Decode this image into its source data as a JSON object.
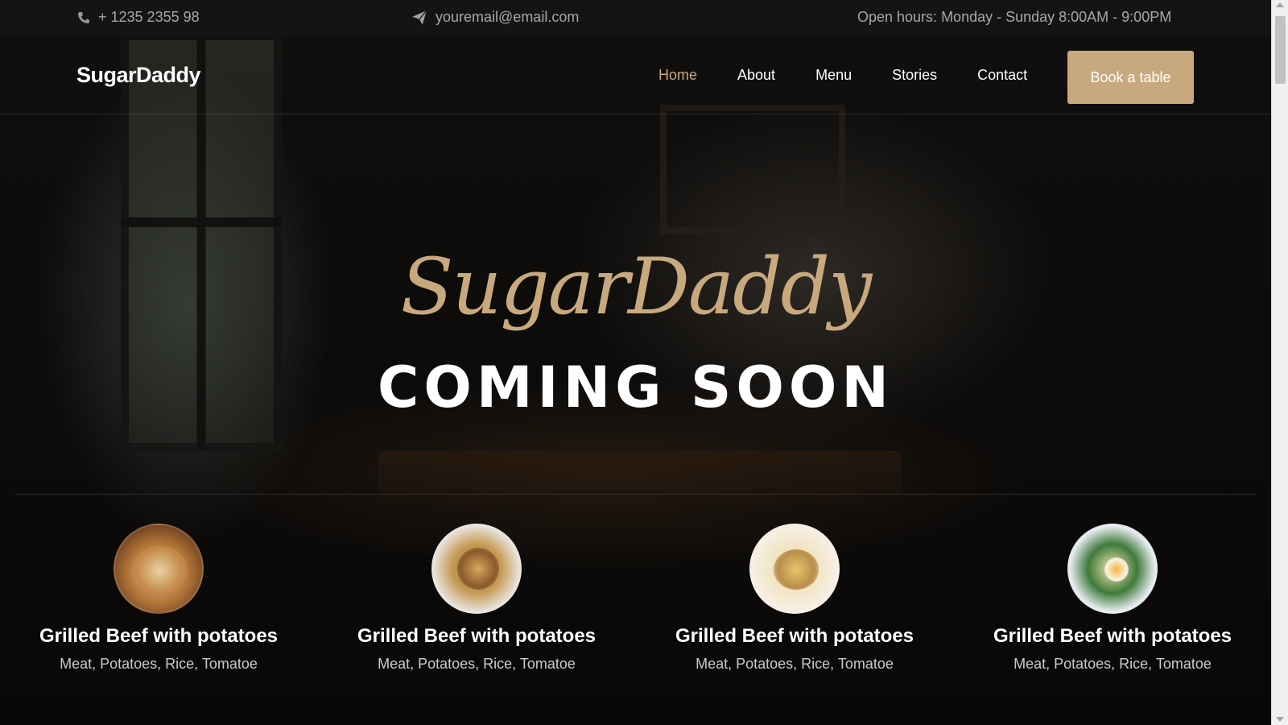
{
  "topbar": {
    "phone": "+ 1235 2355 98",
    "email": "youremail@email.com",
    "hours": "Open hours: Monday - Sunday 8:00AM - 9:00PM",
    "phone_icon": "phone-icon",
    "email_icon": "paper-plane-icon"
  },
  "navbar": {
    "brand": "SugarDaddy",
    "links": [
      {
        "label": "Home",
        "active": true
      },
      {
        "label": "About",
        "active": false
      },
      {
        "label": "Menu",
        "active": false
      },
      {
        "label": "Stories",
        "active": false
      },
      {
        "label": "Contact",
        "active": false
      }
    ],
    "cta": "Book a table"
  },
  "hero": {
    "script_title": "SugarDaddy",
    "headline": "COMING SOON"
  },
  "dishes": [
    {
      "name": "Grilled Beef with potatoes",
      "ingredients": "Meat, Potatoes, Rice, Tomatoe",
      "photo": "noodle-dish-photo"
    },
    {
      "name": "Grilled Beef with potatoes",
      "ingredients": "Meat, Potatoes, Rice, Tomatoe",
      "photo": "salad-bowl-photo"
    },
    {
      "name": "Grilled Beef with potatoes",
      "ingredients": "Meat, Potatoes, Rice, Tomatoe",
      "photo": "banana-bowl-photo"
    },
    {
      "name": "Grilled Beef with potatoes",
      "ingredients": "Meat, Potatoes, Rice, Tomatoe",
      "photo": "egg-salad-photo"
    }
  ],
  "colors": {
    "accent": "#c8a97e",
    "topbar_bg": "#161616"
  }
}
